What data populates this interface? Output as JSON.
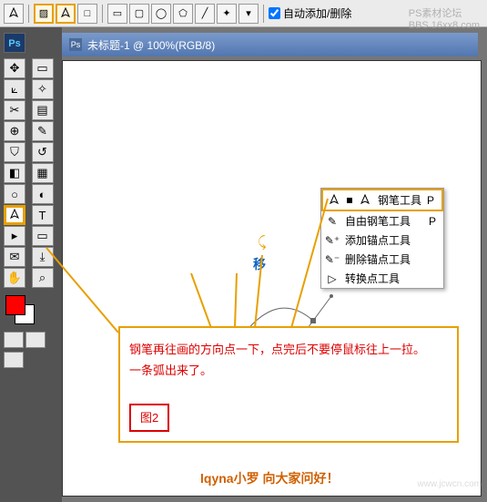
{
  "top": {
    "auto_label": "自动添加/删除"
  },
  "title": "未标题-1 @ 100%(RGB/8)",
  "title_icon": "Ps",
  "ps": "Ps",
  "pen_menu": {
    "items": [
      {
        "label": "钢笔工具",
        "key": "P",
        "selected": true
      },
      {
        "label": "自由钢笔工具",
        "key": "P"
      },
      {
        "label": "添加锚点工具",
        "key": ""
      },
      {
        "label": "删除锚点工具",
        "key": ""
      },
      {
        "label": "转换点工具",
        "key": ""
      }
    ]
  },
  "anno": {
    "line1": "钢笔再往画的方向点一下，点完后不要停鼠标往上一拉。",
    "line2": "一条弧出来了。",
    "fig": "图2"
  },
  "move_label": "移",
  "credit": "lqyna小罗 向大家问好！",
  "watermark1": "PS素材论坛",
  "watermark2": "BBS.16xx8.com",
  "watermark3": "www.jcwcn.com",
  "colors": {
    "highlight": "#e8a000",
    "anno_text": "#d00000",
    "fg": "#ff0000",
    "bg": "#ffffff",
    "title_grad1": "#7a9acc",
    "title_grad2": "#5276b0"
  }
}
